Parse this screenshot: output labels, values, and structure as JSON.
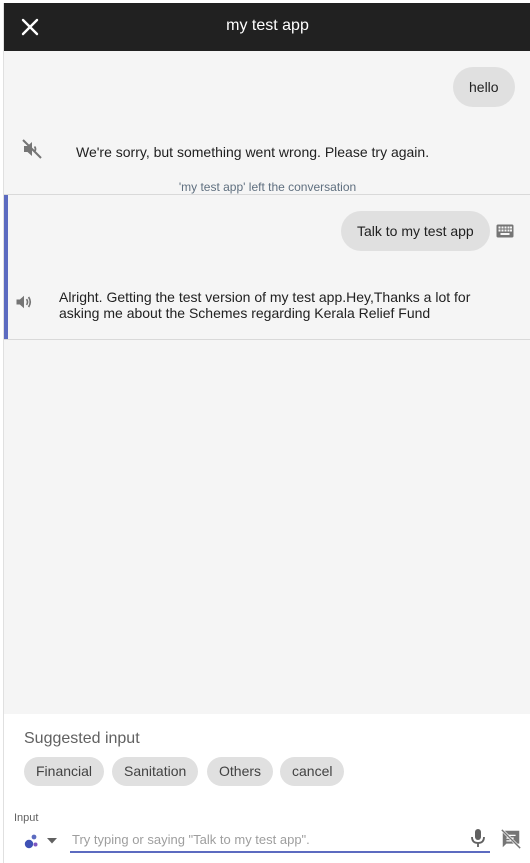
{
  "header": {
    "title": "my test app"
  },
  "conversation": {
    "user_message_1": "hello",
    "bot_error": "We're sorry, but something went wrong. Please try again.",
    "system_note": "'my test app' left the conversation",
    "user_message_2": "Talk to my test app",
    "bot_reply": "Alright. Getting the test version of my test app.Hey,Thanks a lot for asking me about the Schemes regarding Kerala Relief Fund"
  },
  "suggestions": {
    "title": "Suggested input",
    "chips": [
      "Financial",
      "Sanitation",
      "Others",
      "cancel"
    ]
  },
  "input": {
    "label": "Input",
    "placeholder": "Try typing or saying \"Talk to my test app\"."
  },
  "icons": {
    "close": "close-icon",
    "muted": "volume-off-icon",
    "speaker": "volume-up-icon",
    "keyboard": "keyboard-icon",
    "assistant": "assistant-dots-icon",
    "dropdown": "arrow-drop-down-icon",
    "mic": "mic-icon",
    "no_suggestions": "speaker-notes-off-icon"
  },
  "colors": {
    "header_bg": "#212121",
    "accent": "#5c6bc0",
    "bubble_bg": "#e0e0e0",
    "canvas_bg": "#f5f5f5"
  }
}
